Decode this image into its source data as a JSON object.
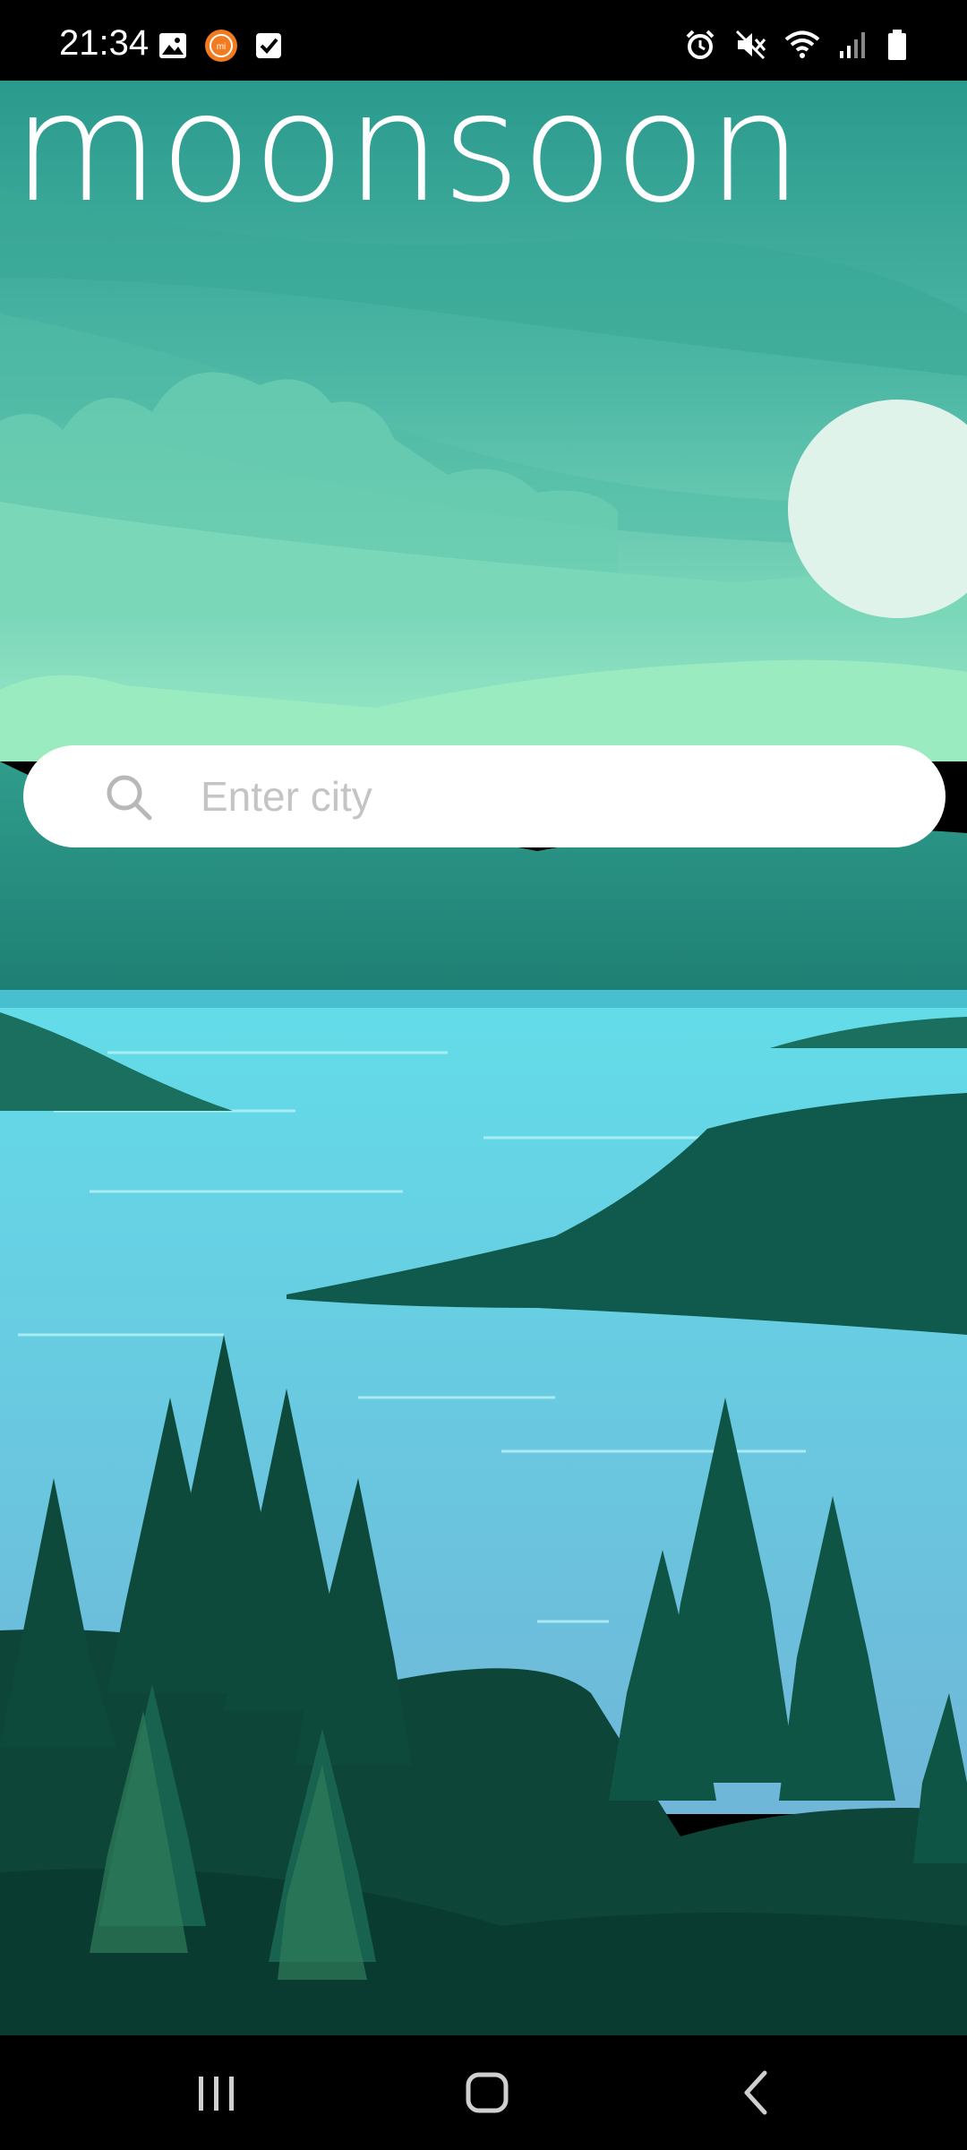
{
  "status_bar": {
    "time": "21:34",
    "left_icons": [
      "gallery-icon",
      "mi-app-icon",
      "checkbox-icon"
    ],
    "right_icons": [
      "alarm-icon",
      "vibrate-mute-icon",
      "wifi-icon",
      "signal-icon",
      "battery-icon"
    ]
  },
  "app": {
    "title": "moonsoon"
  },
  "search": {
    "placeholder": "Enter city",
    "value": ""
  },
  "nav_bar": {
    "buttons": [
      "recent-apps",
      "home",
      "back"
    ]
  },
  "colors": {
    "sky_top": "#2f9e8e",
    "sky_mid": "#6fcfb0",
    "moon": "#dff3ea",
    "water": "#5fd8e6",
    "forest_dark": "#0b3f33",
    "search_bg": "#ffffff",
    "placeholder": "#c4c4c4"
  }
}
